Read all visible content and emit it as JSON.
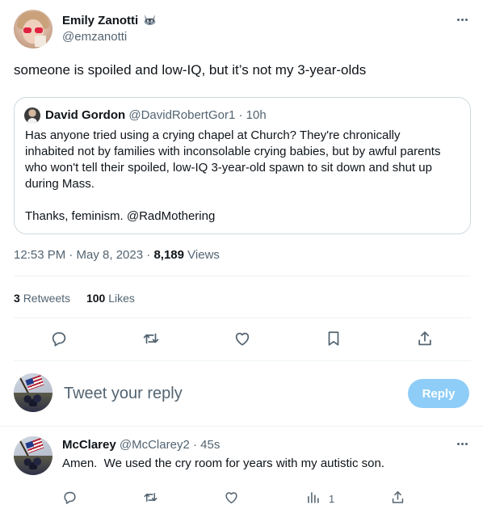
{
  "tweet": {
    "author_name": "Emily Zanotti",
    "author_handle": "@emzanotti",
    "text": "someone is spoiled and low-IQ, but it’s not my 3-year-olds",
    "time": "12:53 PM · May 8, 2023",
    "views_count": "8,189",
    "views_label": "Views",
    "retweets_count": "3",
    "retweets_label": "Retweets",
    "likes_count": "100",
    "likes_label": "Likes"
  },
  "quoted": {
    "author_name": "David Gordon",
    "author_handle": "@DavidRobertGor1",
    "separator": "·",
    "time": "10h",
    "lines": [
      "Has anyone tried using a crying chapel at Church? They're chronically",
      "inhabited not by families with inconsolable crying babies, but by awful parents",
      "who won't tell their spoiled, low-IQ 3-year-old spawn to sit down and shut up",
      "during Mass."
    ],
    "closing": "Thanks, feminism. @RadMothering"
  },
  "compose": {
    "placeholder": "Tweet your reply",
    "button_label": "Reply"
  },
  "reply": {
    "author_name": "McClarey",
    "author_handle": "@McClarey2",
    "separator": "·",
    "time": "45s",
    "text": "Amen.  We used the cry room for years with my autistic son.",
    "views_count": "1"
  },
  "icons": {
    "action_color": "#536471",
    "more": "more-horizontal-icon",
    "badge": "raccoon-icon"
  }
}
